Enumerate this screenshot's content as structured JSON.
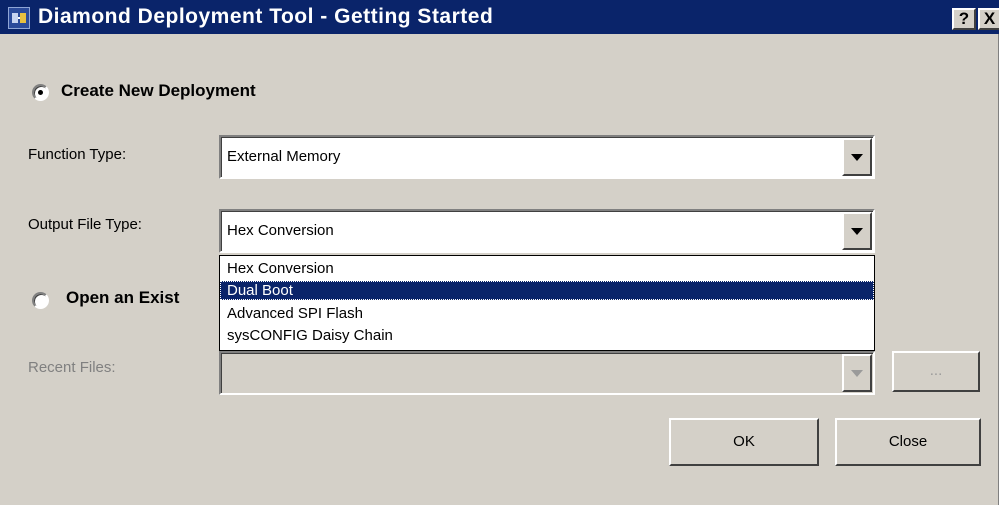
{
  "window": {
    "title": "Diamond Deployment Tool - Getting Started",
    "help_label": "?",
    "close_label": "X"
  },
  "create": {
    "label": "Create New Deployment",
    "selected": true
  },
  "function_type": {
    "label": "Function Type:",
    "value": "External Memory"
  },
  "output_file_type": {
    "label": "Output File Type:",
    "value": "Hex Conversion",
    "options": [
      "Hex Conversion",
      "Dual Boot",
      "Advanced SPI Flash",
      "sysCONFIG Daisy Chain"
    ],
    "highlighted_index": 1
  },
  "open_existing": {
    "label": "Open an Exist",
    "selected": false
  },
  "recent_files": {
    "label": "Recent Files:",
    "value": "",
    "browse_label": "..."
  },
  "buttons": {
    "ok_label": "OK",
    "close_label": "Close"
  },
  "colors": {
    "title_bar": "#0a246a",
    "dialog_face": "#d4d0c8",
    "highlight": "#0a246a"
  }
}
